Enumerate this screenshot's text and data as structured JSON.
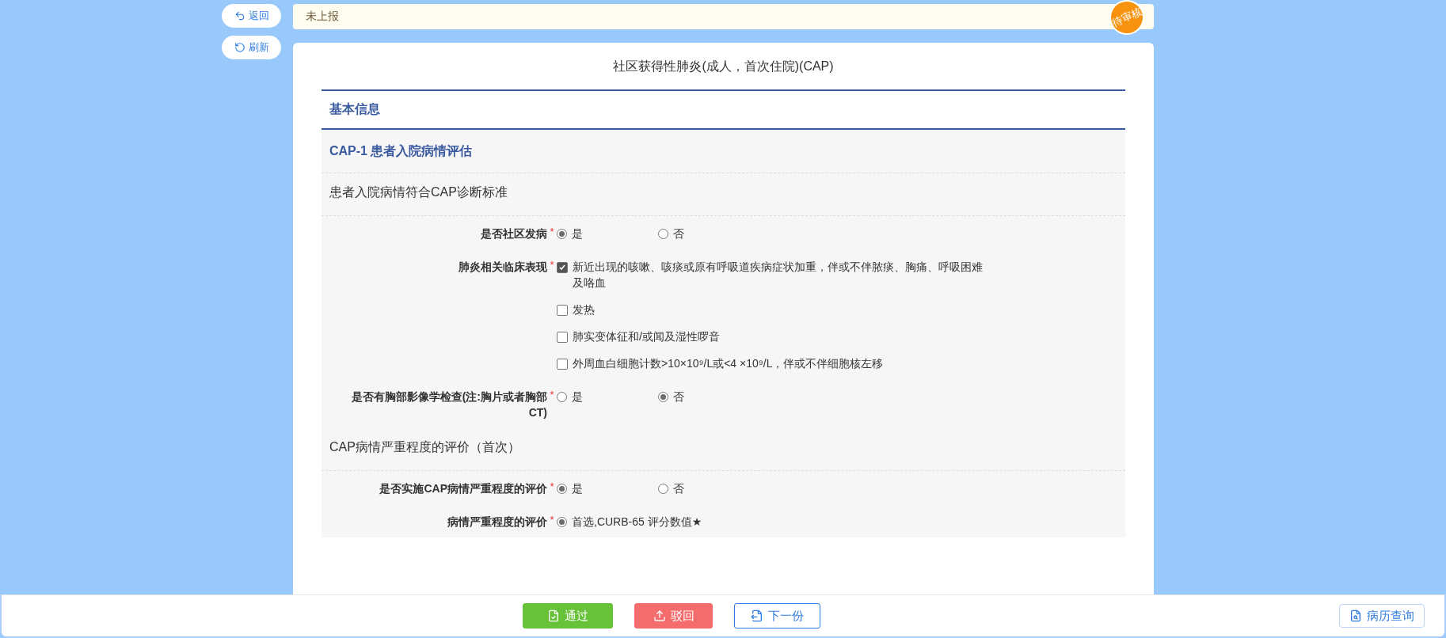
{
  "nav_buttons": [
    {
      "label": "返回",
      "kind": "back"
    },
    {
      "label": "刷新",
      "kind": "refresh"
    }
  ],
  "status": {
    "text": "未上报",
    "badge": "待审核"
  },
  "form": {
    "title": "社区获得性肺炎(成人，首次住院)(CAP)",
    "section": "基本信息",
    "group_title": "CAP-1 患者入院病情评估",
    "items": [
      {
        "kind": "heading",
        "text": "患者入院病情符合CAP诊断标准"
      },
      {
        "kind": "radio",
        "label": "是否社区发病",
        "required_mark": "*",
        "options": [
          {
            "label": "是",
            "selected": true
          },
          {
            "label": "否",
            "selected": false
          }
        ]
      },
      {
        "kind": "checkbox",
        "label": "肺炎相关临床表现",
        "required_mark": "*",
        "options": [
          {
            "label": "新近出现的咳嗽、咳痰或原有呼吸道疾病症状加重，伴或不伴脓痰、胸痛、呼吸困难及咯血",
            "checked": true
          },
          {
            "label": "发热",
            "checked": false
          },
          {
            "label": "肺实变体征和/或闻及湿性啰音",
            "checked": false
          },
          {
            "label": "外周血白细胞计数>10×10⁹/L或<4 ×10⁹/L，伴或不伴细胞核左移",
            "checked": false
          }
        ]
      },
      {
        "kind": "radio",
        "label": "是否有胸部影像学检查(注:胸片或者胸部CT)",
        "required_mark": "*",
        "options": [
          {
            "label": "是",
            "selected": false
          },
          {
            "label": "否",
            "selected": true
          }
        ]
      },
      {
        "kind": "heading",
        "text": "CAP病情严重程度的评价（首次）"
      },
      {
        "kind": "radio",
        "label": "是否实施CAP病情严重程度的评价",
        "required_mark": "*",
        "options": [
          {
            "label": "是",
            "selected": true
          },
          {
            "label": "否",
            "selected": false
          }
        ]
      },
      {
        "kind": "radio",
        "label": "病情严重程度的评价",
        "required_mark": "*",
        "options": [
          {
            "label": "首选,CURB-65 评分数值★",
            "selected": true
          }
        ]
      }
    ]
  },
  "actions": [
    {
      "label": "通过",
      "kind": "approve"
    },
    {
      "label": "驳回",
      "kind": "reject"
    },
    {
      "label": "下一份",
      "kind": "next"
    }
  ],
  "query_button": {
    "label": "病历查询"
  }
}
